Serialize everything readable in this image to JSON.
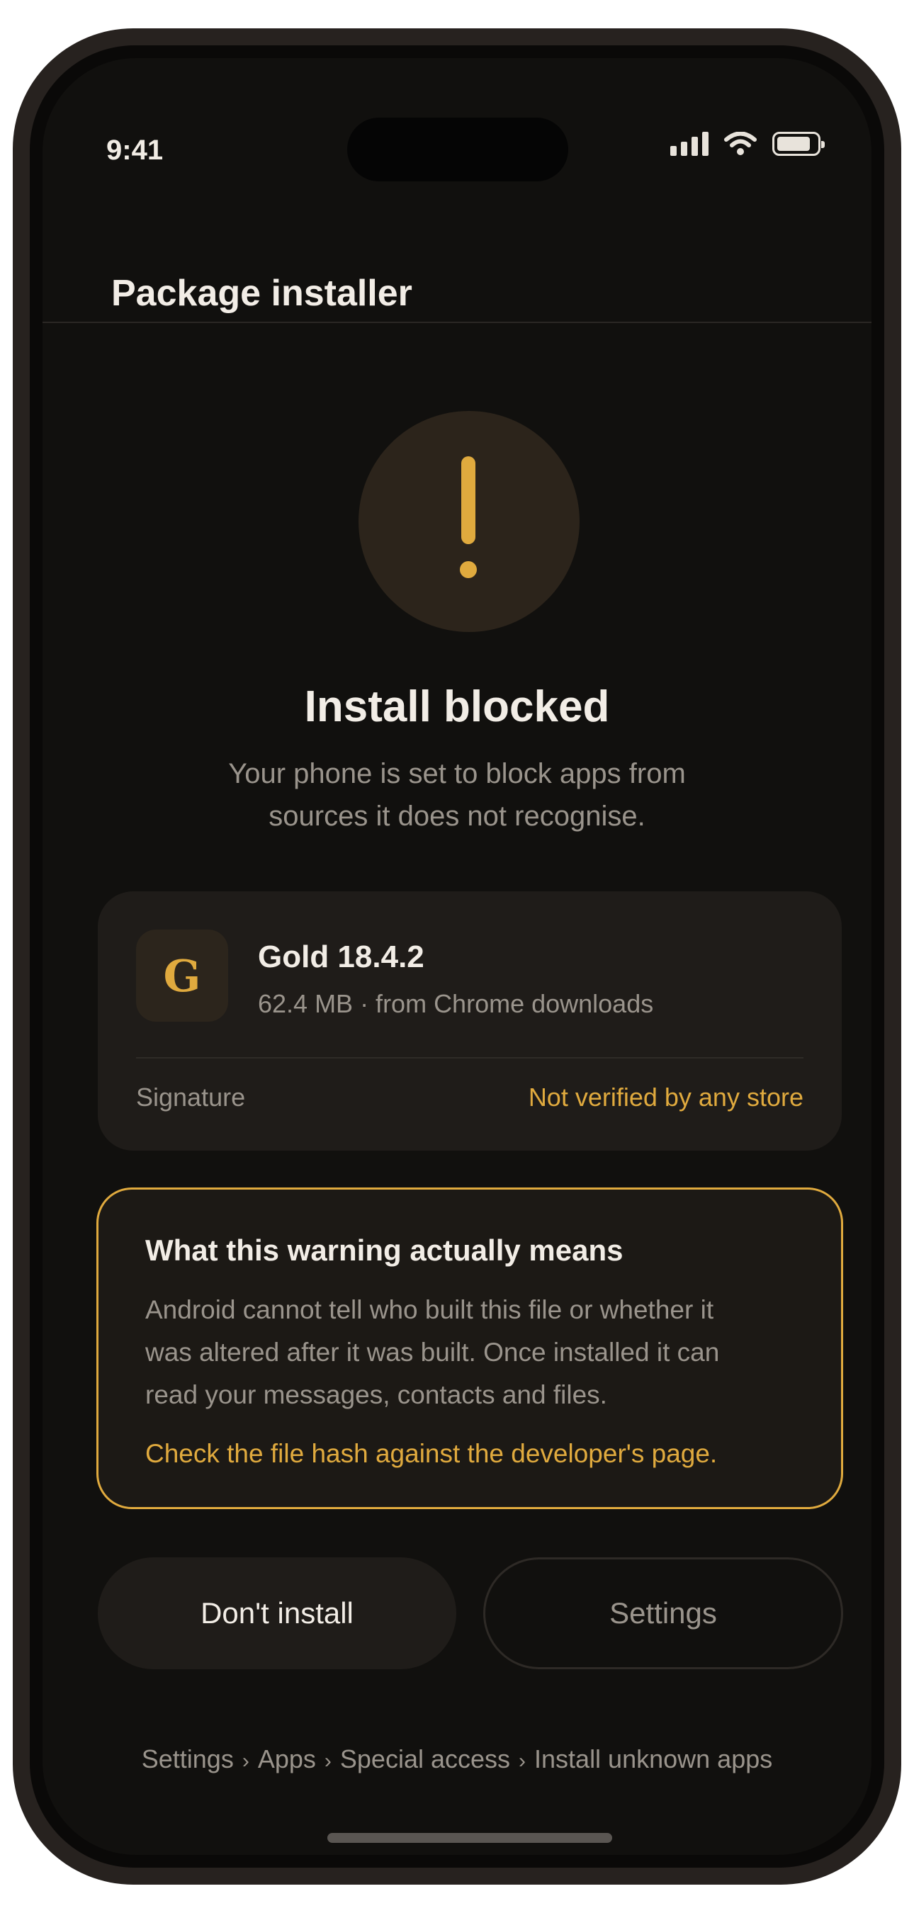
{
  "status_bar": {
    "time": "9:41",
    "icons": [
      "signal-icon",
      "wifi-icon",
      "battery-icon"
    ]
  },
  "header": {
    "title": "Package installer"
  },
  "alert": {
    "icon": "exclamation-icon",
    "title": "Install blocked",
    "message": "Your phone is set to block apps from sources it does not recognise."
  },
  "app_card": {
    "icon_letter": "G",
    "name": "Gold 18.4.2",
    "meta": "62.4 MB · from Chrome downloads",
    "signature_label": "Signature",
    "signature_value": "Not verified by any store"
  },
  "warning": {
    "title": "What this warning actually means",
    "body": "Android cannot tell who built this file or whether it was altered after it was built. Once installed it can read your messages, contacts and files.",
    "link": "Check the file hash against the developer's page."
  },
  "buttons": {
    "primary": "Don't install",
    "secondary": "Settings"
  },
  "breadcrumb": {
    "items": [
      "Settings",
      "Apps",
      "Special access",
      "Install unknown apps"
    ],
    "separator": "›"
  },
  "colors": {
    "accent": "#e0aa3e",
    "background": "#11100e",
    "card": "#1f1c19",
    "text": "#f2ede6",
    "muted": "#9a948c"
  }
}
